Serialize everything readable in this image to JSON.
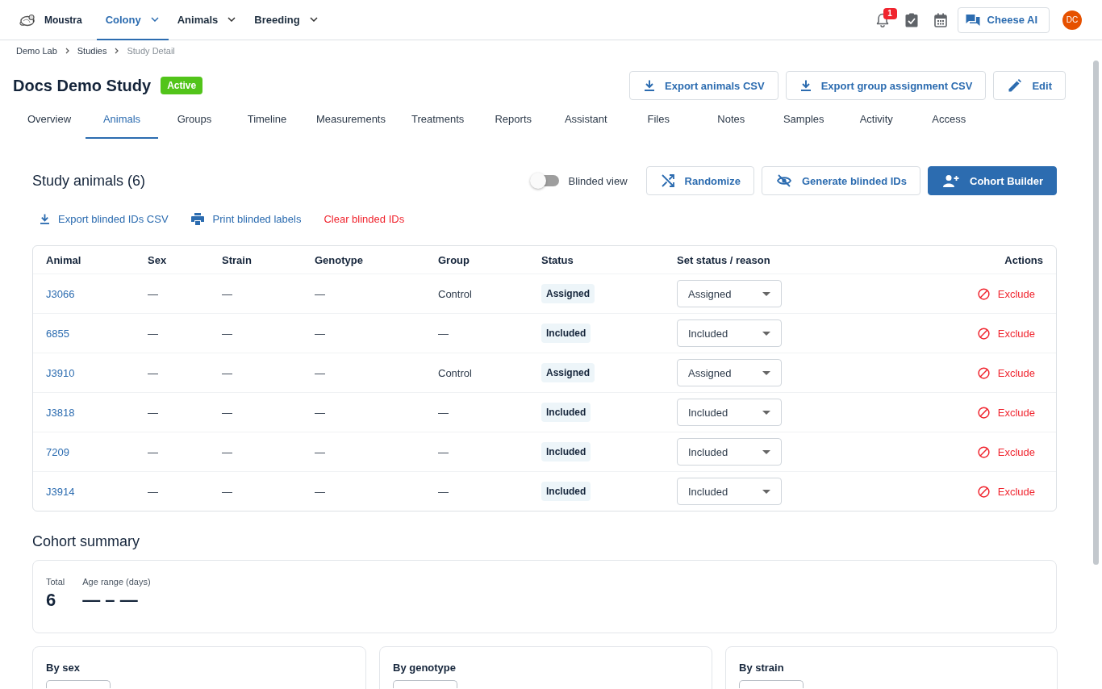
{
  "top_nav": {
    "brand": "Moustra",
    "menus": [
      {
        "label": "Colony",
        "selected": true
      },
      {
        "label": "Animals",
        "selected": false
      },
      {
        "label": "Breeding",
        "selected": false
      }
    ],
    "notification_count": "1",
    "assistant_button": "Cheese AI",
    "avatar_initials": "DC"
  },
  "breadcrumb": [
    "Demo Lab",
    "Studies",
    "Study Detail"
  ],
  "study": {
    "title": "Docs Demo Study",
    "status": "Active",
    "actions": [
      {
        "label": "Export animals CSV",
        "kind": "download"
      },
      {
        "label": "Export group assignment CSV",
        "kind": "download"
      },
      {
        "label": "Edit",
        "kind": "edit"
      }
    ]
  },
  "tabs": [
    {
      "label": "Overview",
      "selected": false
    },
    {
      "label": "Animals",
      "selected": true
    },
    {
      "label": "Groups",
      "selected": false
    },
    {
      "label": "Timeline",
      "selected": false
    },
    {
      "label": "Measurements",
      "selected": false
    },
    {
      "label": "Treatments",
      "selected": false
    },
    {
      "label": "Reports",
      "selected": false
    },
    {
      "label": "Assistant",
      "selected": false
    },
    {
      "label": "Files",
      "selected": false
    },
    {
      "label": "Notes",
      "selected": false
    },
    {
      "label": "Samples",
      "selected": false
    },
    {
      "label": "Activity",
      "selected": false
    },
    {
      "label": "Access",
      "selected": false
    }
  ],
  "animals_section": {
    "title": "Study animals (6)",
    "blinded_view": {
      "label": "Blinded view",
      "on": false
    },
    "buttons": [
      {
        "label": "Randomize",
        "kind": "shuffle",
        "primary": false
      },
      {
        "label": "Generate blinded IDs",
        "kind": "hide",
        "primary": false
      },
      {
        "label": "Cohort Builder",
        "kind": "add_person",
        "primary": true
      }
    ],
    "links": [
      {
        "label": "Export blinded IDs CSV",
        "kind": "download"
      },
      {
        "label": "Print blinded labels",
        "kind": "print"
      },
      {
        "label": "Clear blinded IDs",
        "kind": "danger"
      }
    ]
  },
  "table": {
    "columns": [
      "Animal",
      "Sex",
      "Strain",
      "Genotype",
      "Group",
      "Status",
      "Set status / reason",
      "Actions"
    ],
    "rows": [
      {
        "animal": "J3066",
        "sex": "—",
        "strain": "—",
        "genotype": "—",
        "group": "Control",
        "status": "Assigned",
        "set_status": "Assigned",
        "action": "Exclude"
      },
      {
        "animal": "6855",
        "sex": "—",
        "strain": "—",
        "genotype": "—",
        "group": "—",
        "status": "Included",
        "set_status": "Included",
        "action": "Exclude"
      },
      {
        "animal": "J3910",
        "sex": "—",
        "strain": "—",
        "genotype": "—",
        "group": "Control",
        "status": "Assigned",
        "set_status": "Assigned",
        "action": "Exclude"
      },
      {
        "animal": "J3818",
        "sex": "—",
        "strain": "—",
        "genotype": "—",
        "group": "—",
        "status": "Included",
        "set_status": "Included",
        "action": "Exclude"
      },
      {
        "animal": "7209",
        "sex": "—",
        "strain": "—",
        "genotype": "—",
        "group": "—",
        "status": "Included",
        "set_status": "Included",
        "action": "Exclude"
      },
      {
        "animal": "J3914",
        "sex": "—",
        "strain": "—",
        "genotype": "—",
        "group": "—",
        "status": "Included",
        "set_status": "Included",
        "action": "Exclude"
      }
    ]
  },
  "cohort_summary": {
    "title": "Cohort summary",
    "stats": [
      {
        "label": "Total",
        "value": "6"
      },
      {
        "label": "Age range (days)",
        "value": "— – —"
      }
    ],
    "breakdowns": [
      {
        "title": "By sex"
      },
      {
        "title": "By genotype"
      },
      {
        "title": "By strain"
      }
    ]
  }
}
